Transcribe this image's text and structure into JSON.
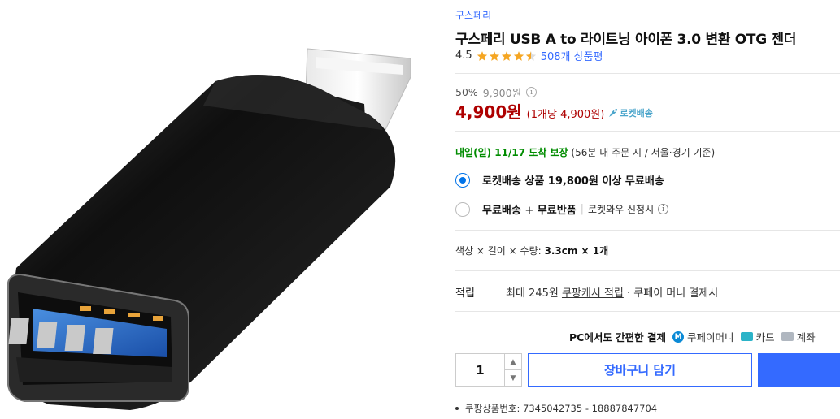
{
  "product": {
    "brand": "구스페리",
    "title": "구스페리 USB A to 라이트닝 아이폰 3.0 변환 OTG 젠더",
    "rating": "4.5",
    "review_count": "508개 상품평"
  },
  "pricing": {
    "discount_rate": "50%",
    "original_price": "9,900원",
    "info_glyph": "i",
    "price": "4,900원",
    "unit_price": "(1개당 4,900원)",
    "rocket_label": "로켓배송"
  },
  "delivery": {
    "highlight": "내일(일) 11/17 도착 보장",
    "note": "(56분  내 주문 시 / 서울·경기 기준)"
  },
  "shipping_options": [
    {
      "label": "로켓배송 상품 19,800원 이상 무료배송",
      "sub": "",
      "selected": true
    },
    {
      "label": "무료배송 + 무료반품",
      "sub": "로켓와우 신청시",
      "selected": false
    }
  ],
  "shipping_sep": "|",
  "option": {
    "label": "색상 × 길이 × 수량:",
    "value": "3.3cm × 1개"
  },
  "reward": {
    "label": "적립",
    "text_prefix": "최대 245원",
    "link": "쿠팡캐시 적립",
    "text_suffix": "· 쿠페이 머니 결제시"
  },
  "payment": {
    "title": "PC에서도 간편한 결제",
    "items": [
      "쿠페이머니",
      "카드",
      "계좌"
    ],
    "money_glyph": "M"
  },
  "purchase": {
    "quantity": "1",
    "up_glyph": "▲",
    "down_glyph": "▼",
    "cart_label": "장바구니 담기"
  },
  "product_code": "쿠팡상품번호: 7345042735 - 18887847704",
  "colors": {
    "accent": "#346aff",
    "price_red": "#ae0000",
    "delivery_green": "#008c00",
    "star": "#f5a623"
  }
}
